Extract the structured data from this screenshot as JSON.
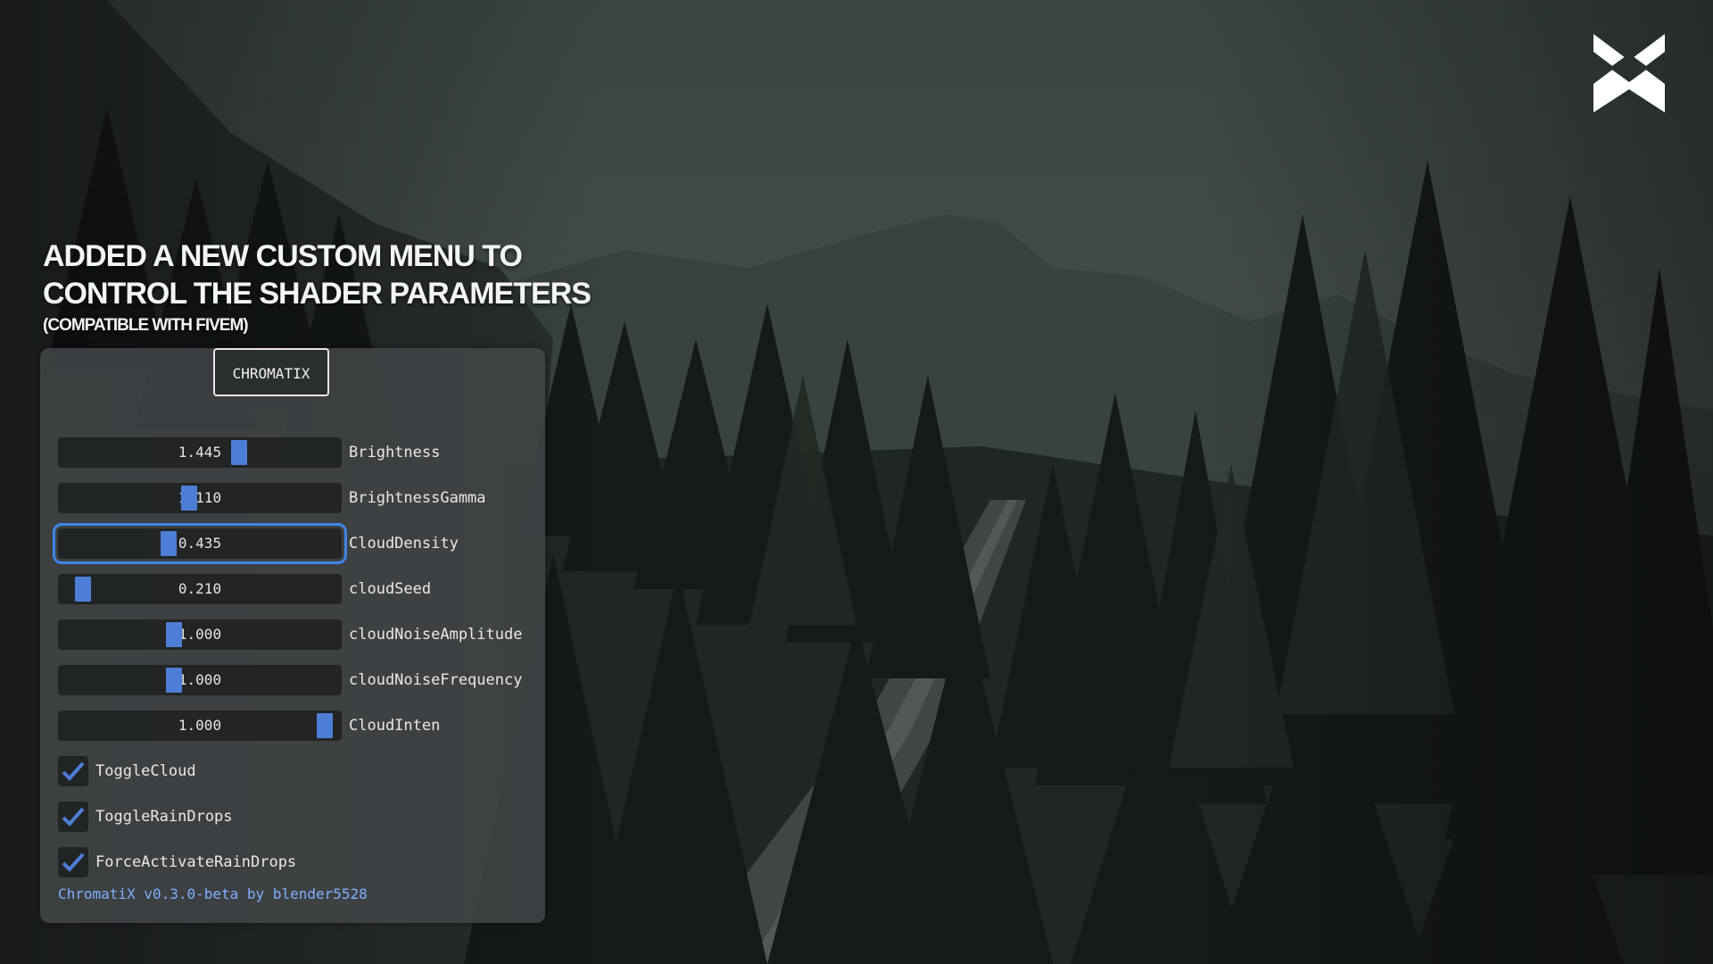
{
  "headline": {
    "line1": "ADDED A NEW CUSTOM MENU TO",
    "line2": "CONTROL THE SHADER PARAMETERS",
    "line3": "(COMPATIBLE WITH FIVEM)"
  },
  "menu": {
    "title": "CHROMATIX",
    "sliders": [
      {
        "label": "Brightness",
        "value": "1.445",
        "fraction": 0.65
      },
      {
        "label": "BrightnessGamma",
        "value": "1.110",
        "fraction": 0.46
      },
      {
        "label": "CloudDensity",
        "value": "0.435",
        "fraction": 0.38
      },
      {
        "label": "cloudSeed",
        "value": "0.210",
        "fraction": 0.05
      },
      {
        "label": "cloudNoiseAmplitude",
        "value": "1.000",
        "fraction": 0.4
      },
      {
        "label": "cloudNoiseFrequency",
        "value": "1.000",
        "fraction": 0.4
      },
      {
        "label": "CloudInten",
        "value": "1.000",
        "fraction": 0.98
      }
    ],
    "focused_slider": "CloudDensity",
    "checkboxes": [
      {
        "label": "ToggleCloud",
        "checked": true
      },
      {
        "label": "ToggleRainDrops",
        "checked": true
      },
      {
        "label": "ForceActivateRainDrops",
        "checked": true
      }
    ],
    "footer": "ChromatiX v0.3.0-beta by blender5528"
  },
  "colors": {
    "accent": "#4d7ed6",
    "focus": "#3f86e8",
    "footer_text": "#7fb0ff"
  },
  "icons": {
    "logo": "chromatix-x-logo",
    "checkbox": "check-mark-icon"
  }
}
